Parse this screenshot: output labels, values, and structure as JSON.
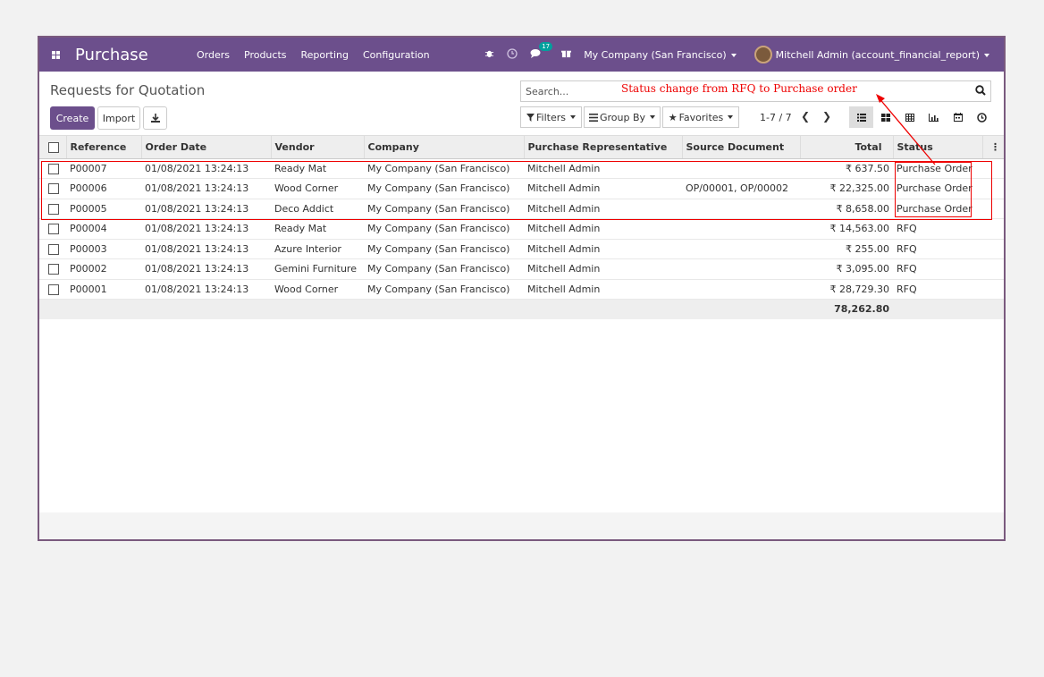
{
  "navbar": {
    "app_title": "Purchase",
    "menu": [
      "Orders",
      "Products",
      "Reporting",
      "Configuration"
    ],
    "message_count": "17",
    "company": "My Company (San Francisco)",
    "user": "Mitchell Admin (account_financial_report)",
    "brand_color": "#6c4f8c"
  },
  "control_panel": {
    "breadcrumb": "Requests for Quotation",
    "create_label": "Create",
    "import_label": "Import",
    "search_placeholder": "Search...",
    "filters_label": "Filters",
    "group_by_label": "Group By",
    "favorites_label": "Favorites",
    "pager": "1-7 / 7"
  },
  "annotation": {
    "text": "Status change from RFQ to Purchase order",
    "color": "#e00000"
  },
  "table": {
    "columns": [
      "Reference",
      "Order Date",
      "Vendor",
      "Company",
      "Purchase Representative",
      "Source Document",
      "Total",
      "Status"
    ],
    "rows": [
      {
        "ref": "P00007",
        "date": "01/08/2021 13:24:13",
        "vendor": "Ready Mat",
        "company": "My Company (San Francisco)",
        "rep": "Mitchell Admin",
        "source": "",
        "total": "₹ 637.50",
        "status": "Purchase Order"
      },
      {
        "ref": "P00006",
        "date": "01/08/2021 13:24:13",
        "vendor": "Wood Corner",
        "company": "My Company (San Francisco)",
        "rep": "Mitchell Admin",
        "source": "OP/00001, OP/00002",
        "total": "₹ 22,325.00",
        "status": "Purchase Order"
      },
      {
        "ref": "P00005",
        "date": "01/08/2021 13:24:13",
        "vendor": "Deco Addict",
        "company": "My Company (San Francisco)",
        "rep": "Mitchell Admin",
        "source": "",
        "total": "₹ 8,658.00",
        "status": "Purchase Order"
      },
      {
        "ref": "P00004",
        "date": "01/08/2021 13:24:13",
        "vendor": "Ready Mat",
        "company": "My Company (San Francisco)",
        "rep": "Mitchell Admin",
        "source": "",
        "total": "₹ 14,563.00",
        "status": "RFQ"
      },
      {
        "ref": "P00003",
        "date": "01/08/2021 13:24:13",
        "vendor": "Azure Interior",
        "company": "My Company (San Francisco)",
        "rep": "Mitchell Admin",
        "source": "",
        "total": "₹ 255.00",
        "status": "RFQ"
      },
      {
        "ref": "P00002",
        "date": "01/08/2021 13:24:13",
        "vendor": "Gemini Furniture",
        "company": "My Company (San Francisco)",
        "rep": "Mitchell Admin",
        "source": "",
        "total": "₹ 3,095.00",
        "status": "RFQ"
      },
      {
        "ref": "P00001",
        "date": "01/08/2021 13:24:13",
        "vendor": "Wood Corner",
        "company": "My Company (San Francisco)",
        "rep": "Mitchell Admin",
        "source": "",
        "total": "₹ 28,729.30",
        "status": "RFQ"
      }
    ],
    "grand_total": "78,262.80"
  }
}
